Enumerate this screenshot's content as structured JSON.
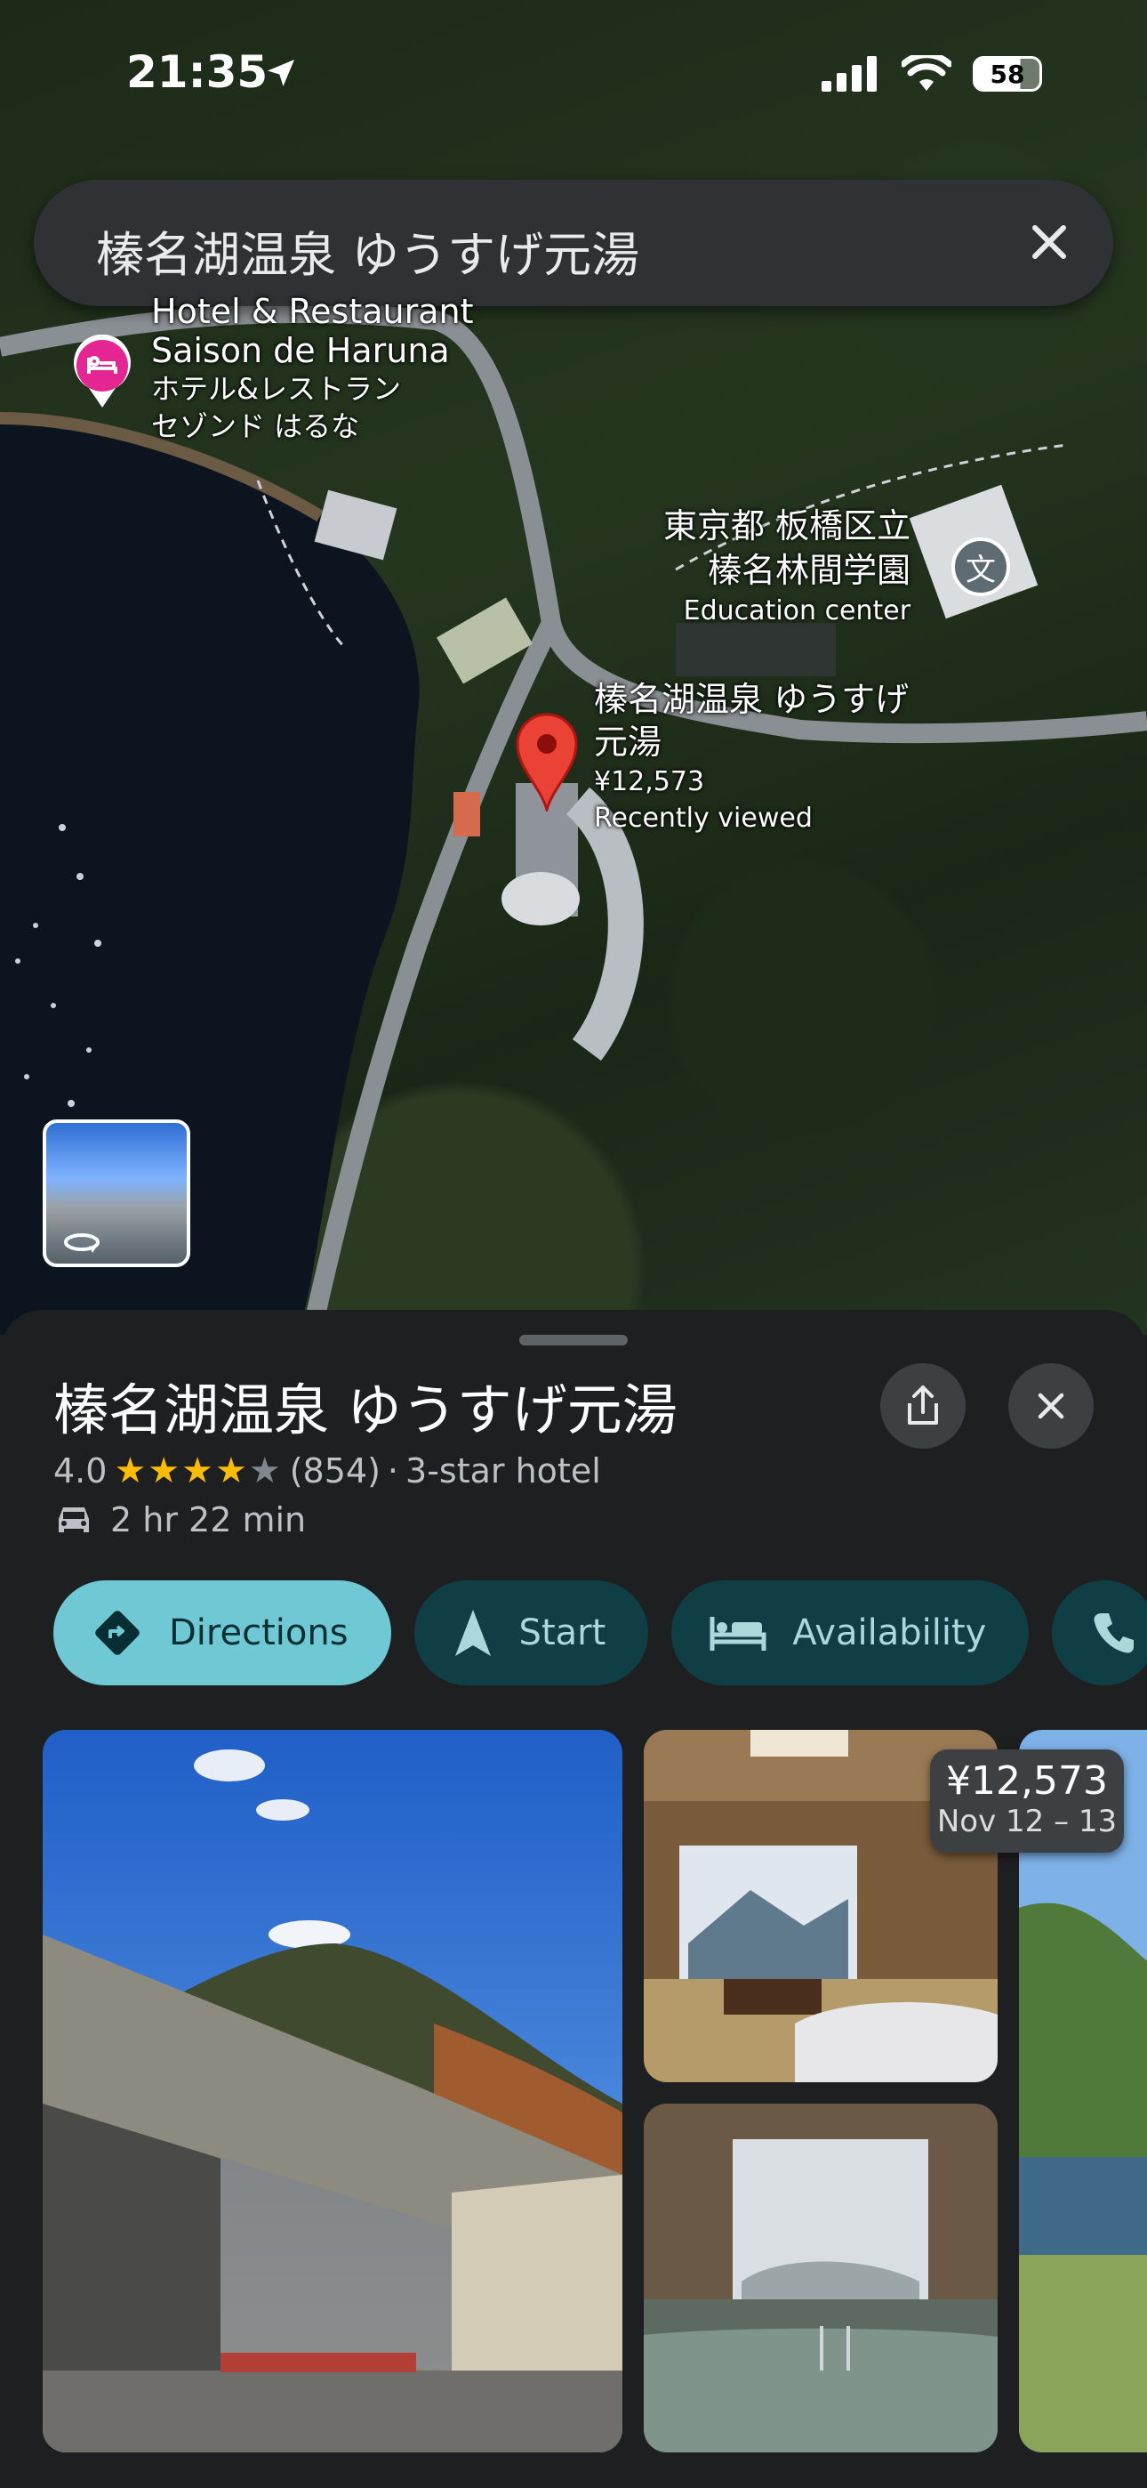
{
  "status_bar": {
    "time": "21:35",
    "battery": "58"
  },
  "search": {
    "query": "榛名湖温泉 ゆうすげ元湯"
  },
  "map": {
    "labels": {
      "hotel_en_1": "Hotel & Restaurant",
      "hotel_en_2": "Saison de Haruna",
      "hotel_jp_1": "ホテル&レストラン",
      "hotel_jp_2": "セゾンド はるな",
      "school_1": "東京都 板橋区立",
      "school_2": "榛名林間学園",
      "school_type": "Education center",
      "selected_1": "榛名湖温泉 ゆうすげ",
      "selected_2": "元湯",
      "selected_price": "¥12,573",
      "selected_note": "Recently viewed"
    }
  },
  "place": {
    "title": "榛名湖温泉 ゆうすげ元湯",
    "rating": "4.0",
    "stars_full": "★★★★",
    "stars_empty": "★",
    "reviews": "(854)",
    "separator": "·",
    "category": "3-star hotel",
    "drive_time": "2 hr 22 min"
  },
  "actions": {
    "directions": "Directions",
    "start": "Start",
    "availability": "Availability"
  },
  "price_badge": {
    "price": "¥12,573",
    "dates": "Nov 12 – 13"
  },
  "colors": {
    "chip_primary": "#6fc9d4",
    "chip": "#0f3f44",
    "star": "#fbbc04",
    "pin": "#ea4335"
  }
}
